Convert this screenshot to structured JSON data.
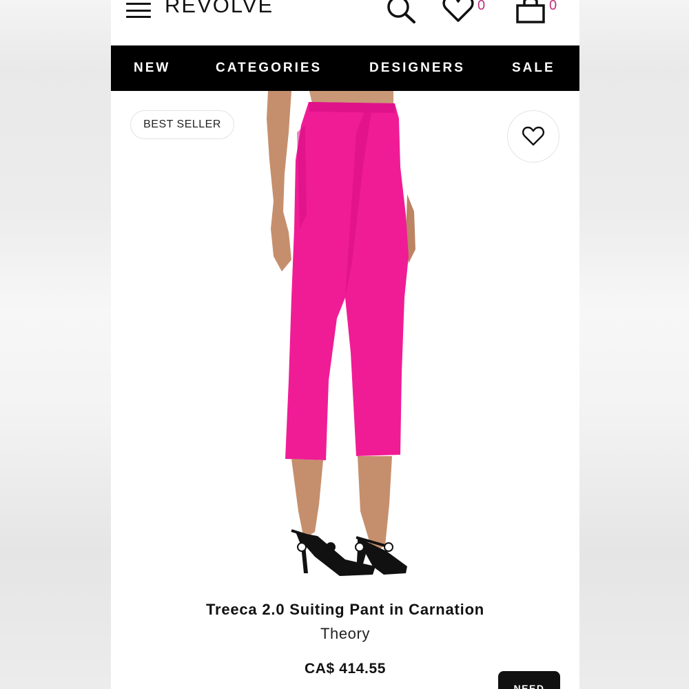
{
  "header": {
    "logo": "REVOLVE",
    "wishlist_count": "0",
    "bag_count": "0",
    "icons": [
      "menu-icon",
      "search-icon",
      "heart-icon",
      "bag-icon"
    ]
  },
  "nav": {
    "items": [
      "NEW",
      "CATEGORIES",
      "DESIGNERS",
      "SALE"
    ]
  },
  "product": {
    "badge": "BEST SELLER",
    "name": "Treeca 2.0 Suiting Pant in Carnation",
    "brand": "Theory",
    "price": "CA$ 414.55",
    "image_count": 4,
    "active_image_index": 1
  },
  "help_button": "NEED",
  "colors": {
    "accent_count": "#c0307a",
    "nav_bg": "#000000",
    "pant": "#f01c96"
  }
}
